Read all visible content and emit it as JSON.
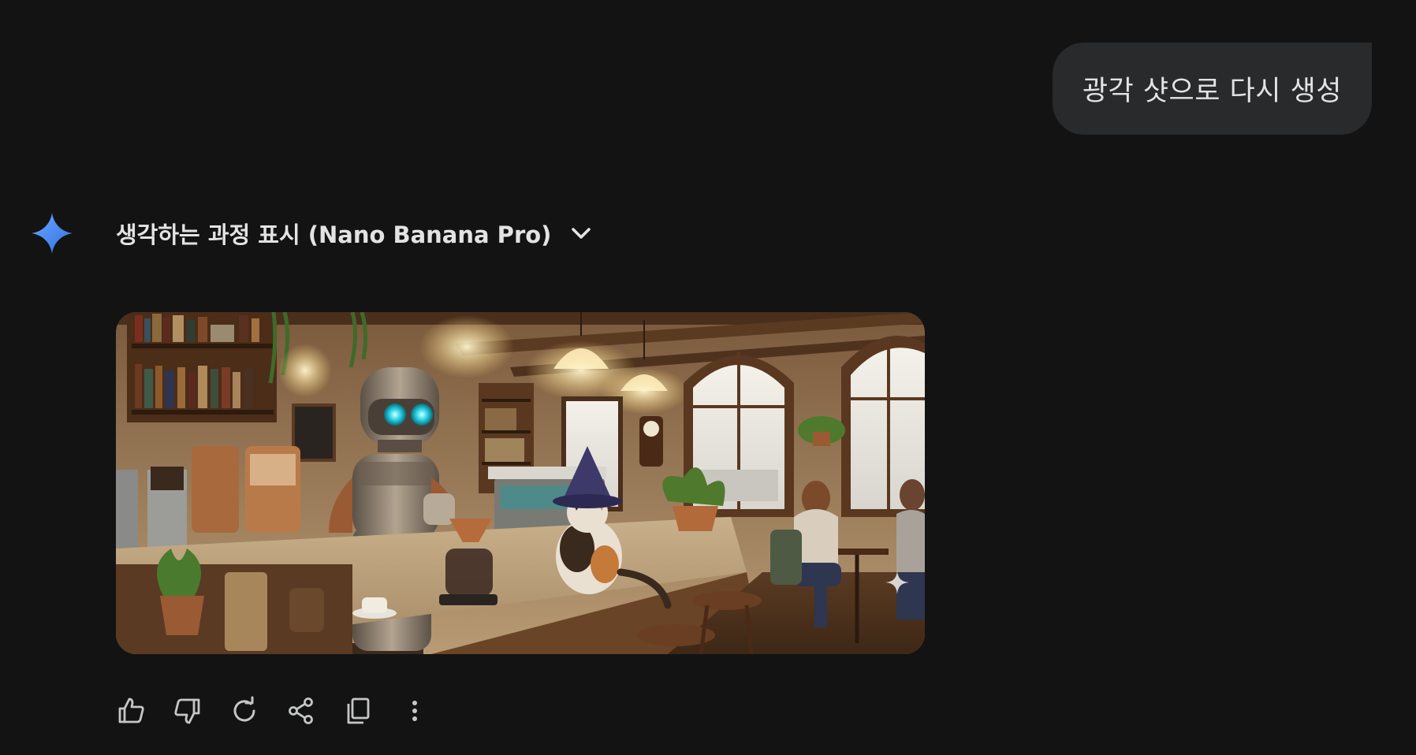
{
  "user_message": {
    "text": "광각 샷으로 다시 생성"
  },
  "model_response": {
    "thinking_label": "생각하는 과정 표시 (Nano Banana Pro)",
    "image": {
      "alt": "robot barista and wizard-hat cat in a cozy cafe"
    },
    "actions": [
      {
        "name": "good-response",
        "icon": "thumb-up-icon"
      },
      {
        "name": "bad-response",
        "icon": "thumb-down-icon"
      },
      {
        "name": "regenerate",
        "icon": "refresh-icon"
      },
      {
        "name": "share",
        "icon": "share-icon"
      },
      {
        "name": "copy",
        "icon": "copy-icon"
      },
      {
        "name": "more",
        "icon": "more-vert-icon"
      }
    ]
  },
  "colors": {
    "background": "#131314",
    "bubble": "#282a2c",
    "text": "#e3e3e3",
    "spark_blue": "#4285f4"
  }
}
